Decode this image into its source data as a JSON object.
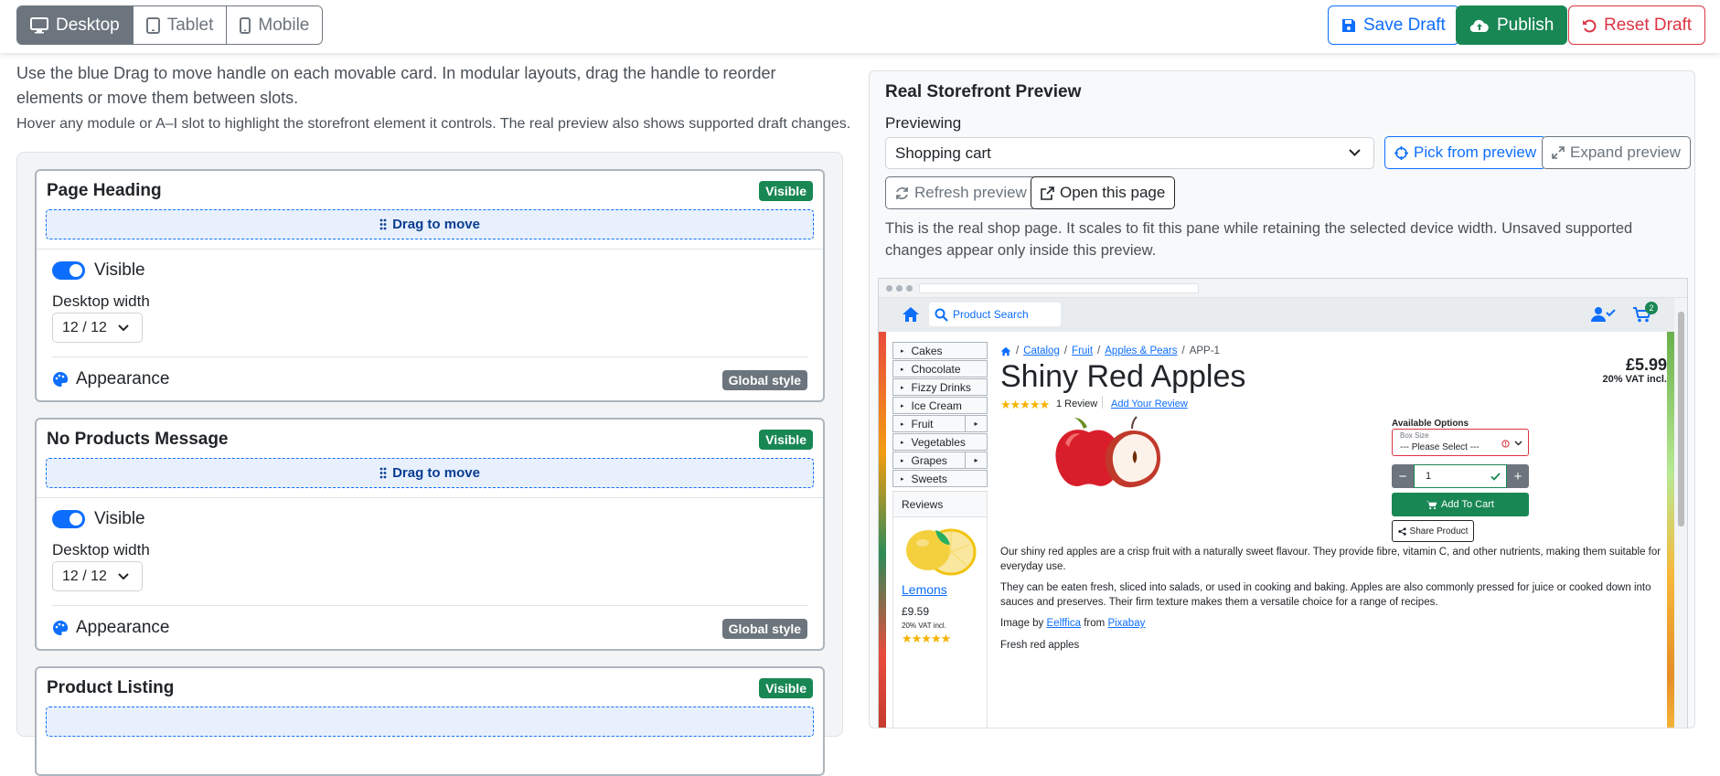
{
  "topbar": {
    "devices": [
      {
        "label": "Desktop",
        "icon": "desktop-icon",
        "active": true
      },
      {
        "label": "Tablet",
        "icon": "tablet-icon",
        "active": false
      },
      {
        "label": "Mobile",
        "icon": "mobile-icon",
        "active": false
      }
    ],
    "save_label": "Save Draft",
    "publish_label": "Publish",
    "reset_label": "Reset Draft"
  },
  "intro": {
    "line1": "Use the blue Drag to move handle on each movable card. In modular layouts, drag the handle to reorder elements or move them between slots.",
    "line2": "Hover any module or A–I slot to highlight the storefront element it controls. The real preview also shows supported draft changes."
  },
  "modules": [
    {
      "title": "Page Heading",
      "badge": "Visible",
      "drag_label": "Drag to move",
      "visible_label": "Visible",
      "width_label": "Desktop width",
      "width_value": "12 / 12",
      "appearance_label": "Appearance",
      "appearance_badge": "Global style"
    },
    {
      "title": "No Products Message",
      "badge": "Visible",
      "drag_label": "Drag to move",
      "visible_label": "Visible",
      "width_label": "Desktop width",
      "width_value": "12 / 12",
      "appearance_label": "Appearance",
      "appearance_badge": "Global style"
    },
    {
      "title": "Product Listing",
      "badge": "Visible"
    }
  ],
  "preview": {
    "title": "Real Storefront Preview",
    "previewing_label": "Previewing",
    "selected_page": "Shopping cart",
    "pick_label": "Pick from preview",
    "expand_label": "Expand preview",
    "refresh_label": "Refresh preview",
    "open_label": "Open this page",
    "description": "This is the real shop page. It scales to fit this pane while retaining the selected device width. Unsaved supported changes appear only inside this preview."
  },
  "shop": {
    "search_placeholder": "Product Search",
    "cart_count": "2",
    "categories": [
      {
        "label": "Cakes",
        "sub": false
      },
      {
        "label": "Chocolate",
        "sub": false
      },
      {
        "label": "Fizzy Drinks",
        "sub": false
      },
      {
        "label": "Ice Cream",
        "sub": false
      },
      {
        "label": "Fruit",
        "sub": true
      },
      {
        "label": "Vegetables",
        "sub": false
      },
      {
        "label": "Grapes",
        "sub": true
      },
      {
        "label": "Sweets",
        "sub": false
      }
    ],
    "reviews_title": "Reviews",
    "review_product": "Lemons",
    "review_price": "£9.59",
    "review_vat": "20% VAT incl.",
    "review_rating": 5,
    "breadcrumb": [
      "Catalog",
      "Fruit",
      "Apples & Pears"
    ],
    "breadcrumb_current": "APP-1",
    "product_title": "Shiny Red Apples",
    "price": "£5.99",
    "vat": "20% VAT incl.",
    "rating": 5,
    "reviews_count": "1 Review",
    "add_review": "Add Your Review",
    "options_title": "Available Options",
    "option_label": "Box Size",
    "option_value": "--- Please Select ---",
    "quantity": "1",
    "add_to_cart": "Add To Cart",
    "share": "Share Product",
    "desc1": "Our shiny red apples are a crisp fruit with a naturally sweet flavour. They provide fibre, vitamin C, and other nutrients, making them suitable for everyday use.",
    "desc2": "They can be eaten fresh, sliced into salads, or used in cooking and baking. Apples are also commonly pressed for juice or cooked down into sauces and preserves. Their firm texture makes them a versatile choice for a range of recipes.",
    "credit_prefix": "Image by",
    "credit_author": "Eelffica",
    "credit_mid": "from",
    "credit_source": "Pixabay",
    "caption": "Fresh red apples"
  },
  "colors": {
    "primary": "#0d6efd",
    "success": "#198754",
    "danger": "#dc3545",
    "secondary": "#6c757d"
  }
}
